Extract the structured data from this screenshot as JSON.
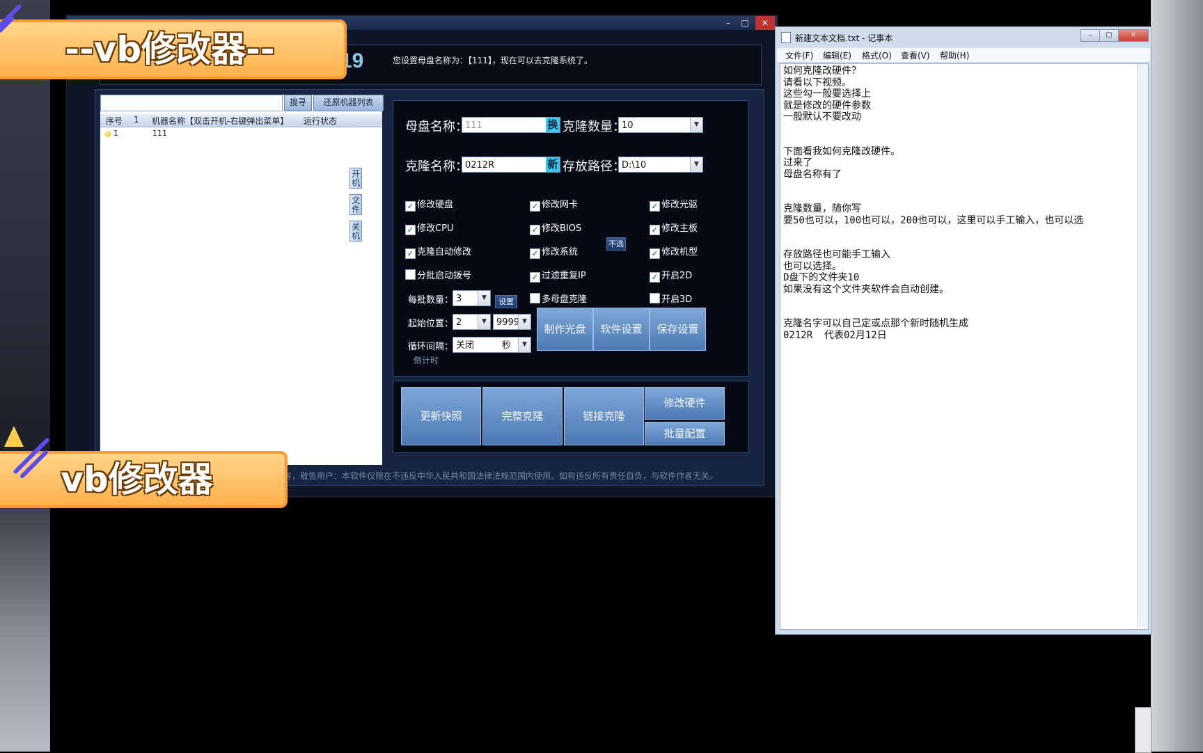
{
  "watermarks": {
    "top": "--vb修改器--",
    "bottom": "vb修改器"
  },
  "app": {
    "window_buttons": {
      "minimize": "–",
      "maximize": "□",
      "close": "✕"
    },
    "header": {
      "logo_fragment": "19",
      "status_message": "您设置母盘名称为：【111】，现在可以去克隆系统了。"
    },
    "list": {
      "search_button": "搜寻",
      "restore_button": "还原机器列表",
      "columns": {
        "index": "序号",
        "index_count": "1",
        "name": "机器名称【双击开机-右键弹出菜单】",
        "status": "运行状态"
      },
      "rows": [
        {
          "index": "1",
          "name": "111"
        }
      ],
      "side_buttons": {
        "power_on": "开\n机",
        "file": "文\n件",
        "power_off": "关\n机"
      }
    },
    "settings": {
      "master_name_label": "母盘名称：",
      "master_name_value": "111",
      "master_name_tag": "换",
      "clone_count_label": "克隆数量：",
      "clone_count_value": "10",
      "clone_name_label": "克隆名称：",
      "clone_name_value": "0212R",
      "clone_name_tag": "新",
      "storage_path_label": "存放路径：",
      "storage_path_value": "D:\\10",
      "checkboxes": {
        "modify_disk": "修改硬盘",
        "modify_nic": "修改网卡",
        "modify_optical": "修改光驱",
        "modify_cpu": "修改CPU",
        "modify_bios": "修改BIOS",
        "modify_motherboard": "修改主板",
        "clone_auto_modify": "克隆自动修改",
        "modify_system": "修改系统",
        "modify_model": "修改机型",
        "batch_dial": "分批启动拨号",
        "filter_dup_ip": "过滤重复IP",
        "enable_2d": "开启2D",
        "multi_master": "多母盘克隆",
        "enable_3d": "开启3D"
      },
      "unselect_button": "不选",
      "batch_count_label": "每批数量：",
      "batch_count_value": "3",
      "set_button": "设置",
      "start_pos_label": "起始位置：",
      "start_pos_value": "2",
      "end_pos_value": "9999",
      "loop_interval_label": "循环间隔：",
      "loop_interval_value": "关闭",
      "loop_interval_unit": "秒",
      "countdown_label": "倒计时",
      "make_disc_button": "制作光盘",
      "software_settings_button": "软件设置",
      "save_settings_button": "保存设置"
    },
    "actions": {
      "update_snapshot": "更新快照",
      "full_clone": "完整克隆",
      "linked_clone": "链接克隆",
      "modify_hardware": "修改硬件",
      "batch_config": "批量配置"
    },
    "footer": "有，敬告用户：本软件仅限在不违反中华人民共和国法律法规范围内使用。如有违反所有责任自负，与软件作者无关。"
  },
  "notepad": {
    "title": "新建文本文档.txt - 记事本",
    "window_buttons": {
      "minimize": "–",
      "maximize": "□",
      "close": "✕"
    },
    "menu": [
      "文件(F)",
      "编辑(E)",
      "格式(O)",
      "查看(V)",
      "帮助(H)"
    ],
    "content": "如何克隆改硬件？\n请看以下视频。\n这些勾一般要选择上\n就是修改的硬件参数\n一般默认不要改动\n\n\n下面看我如何克隆改硬件。\n过来了\n母盘名称有了\n\n\n克隆数量，随你写\n要50也可以，100也可以，200也可以，这里可以手工输入，也可以选\n\n\n存放路径也可能手工输入\n也可以选择。\nD盘下的文件夹10\n如果没有这个文件夹软件会自动创建。\n\n\n克隆名字可以自己定或点那个新时随机生成\n0212R  代表02月12日"
  },
  "colors": {
    "accent_cyan": "#38c8ef",
    "button_blue": "#4c79b4",
    "panel_dark": "#050a15",
    "banner_orange": "#ffb24d"
  }
}
